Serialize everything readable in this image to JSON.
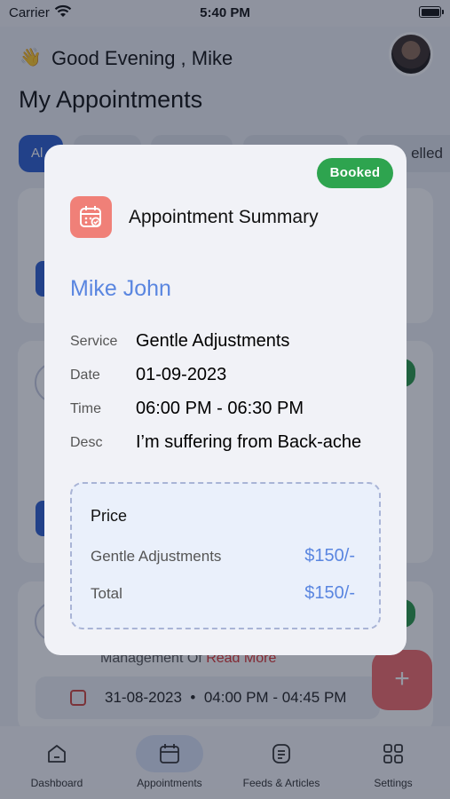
{
  "status_bar": {
    "carrier": "Carrier",
    "time": "5:40 PM"
  },
  "header": {
    "wave_emoji": "👋",
    "greeting": "Good Evening , Mike"
  },
  "page_title": "My Appointments",
  "filter_tabs": {
    "first_partial": "Al",
    "last_partial": "elled"
  },
  "background_card": {
    "desc_partial": "Management Of",
    "read_more": "Read More",
    "date": "31-08-2023",
    "separator": "•",
    "time": "04:00 PM - 04:45 PM"
  },
  "fab_label": "+",
  "bottom_nav": [
    {
      "label": "Dashboard",
      "icon": "dashboard-icon"
    },
    {
      "label": "Appointments",
      "icon": "calendar-icon",
      "active": true
    },
    {
      "label": "Feeds & Articles",
      "icon": "article-icon"
    },
    {
      "label": "Settings",
      "icon": "grid-icon"
    }
  ],
  "modal": {
    "status_badge": "Booked",
    "status_color": "#2ea44f",
    "title": "Appointment Summary",
    "patient_name": "Mike John",
    "details": {
      "service_label": "Service",
      "service_value": "Gentle Adjustments",
      "date_label": "Date",
      "date_value": "01-09-2023",
      "time_label": "Time",
      "time_value": "06:00 PM - 06:30 PM",
      "desc_label": "Desc",
      "desc_value": "I’m suffering from Back-ache"
    },
    "price": {
      "heading": "Price",
      "item_label": "Gentle Adjustments",
      "item_amount": "$150/-",
      "total_label": "Total",
      "total_amount": "$150/-"
    }
  }
}
